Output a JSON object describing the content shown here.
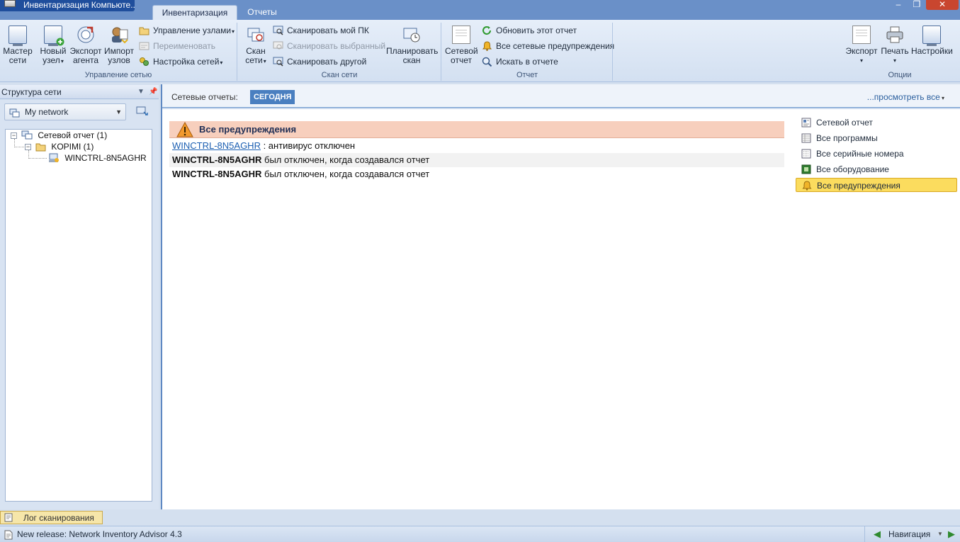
{
  "window": {
    "title": "Инвентаризация Компьюте...",
    "controls": {
      "minimize": "‒",
      "maximize": "❐",
      "close": "✕"
    }
  },
  "tabs": [
    {
      "label": "Инвентаризация",
      "active": true
    },
    {
      "label": "Отчеты",
      "active": false
    }
  ],
  "ribbon": {
    "network_group": {
      "label": "Управление сетью",
      "wizard": [
        "Мастер",
        "сети"
      ],
      "new_node": [
        "Новый",
        "узел"
      ],
      "export_agent": [
        "Экспорт",
        "агента"
      ],
      "import_nodes": [
        "Импорт",
        "узлов"
      ],
      "manage_nodes": "Управление узлами",
      "rename": "Переименовать",
      "network_settings": "Настройка сетей"
    },
    "scan_group": {
      "label": "Скан сети",
      "scan_network": [
        "Скан",
        "сети"
      ],
      "scan_my_pc": "Сканировать мой ПК",
      "scan_selected": "Сканировать выбранный",
      "scan_other": "Сканировать другой",
      "schedule_scan": [
        "Планировать",
        "скан"
      ]
    },
    "report_group": {
      "label": "Отчет",
      "network_report": [
        "Сетевой",
        "отчет"
      ],
      "refresh_report": "Обновить этот отчет",
      "all_warnings": "Все сетевые предупреждения",
      "search_report": "Искать в отчете"
    },
    "options_group": {
      "label": "Опции",
      "export": "Экспорт",
      "print": "Печать",
      "settings": "Настройки"
    }
  },
  "left_panel": {
    "title": "Структура сети",
    "network_select": "My network",
    "tree": [
      {
        "label": "Сетевой отчет (1)",
        "level": 0
      },
      {
        "label": "KOPIMI (1)",
        "level": 1
      },
      {
        "label": "WINCTRL-8N5AGHR",
        "level": 2
      }
    ]
  },
  "reports_bar": {
    "label": "Сетевые отчеты:",
    "today": "СЕГОДНЯ",
    "view_all": "...просмотреть все"
  },
  "warnings": {
    "title": "Все предупреждения",
    "rows": [
      {
        "host": "WINCTRL-8N5AGHR",
        "text": " : антивирус отключен",
        "link": true
      },
      {
        "host": "WINCTRL-8N5AGHR",
        "text": " был отключен, когда создавался отчет",
        "link": false
      },
      {
        "host": "WINCTRL-8N5AGHR",
        "text": " был отключен, когда создавался отчет",
        "link": false
      }
    ]
  },
  "nav_list": [
    {
      "label": "Сетевой отчет",
      "icon": "report-icon",
      "active": false
    },
    {
      "label": "Все программы",
      "icon": "programs-icon",
      "active": false
    },
    {
      "label": "Все серийные номера",
      "icon": "serials-icon",
      "active": false
    },
    {
      "label": "Все оборудование",
      "icon": "hardware-icon",
      "active": false
    },
    {
      "label": "Все предупреждения",
      "icon": "bell-icon",
      "active": true
    }
  ],
  "bottom": {
    "log_tab": "Лог сканирования",
    "status": "New release: Network Inventory Advisor 4.3",
    "navigation": "Навигация"
  },
  "colors": {
    "title_bar": "#6a90c8",
    "ribbon": "#dfe8f5",
    "warning_header": "#f7cfbd",
    "active_nav": "#fbdc5e",
    "today_badge": "#4a7fc0",
    "close_button": "#c9462f"
  }
}
